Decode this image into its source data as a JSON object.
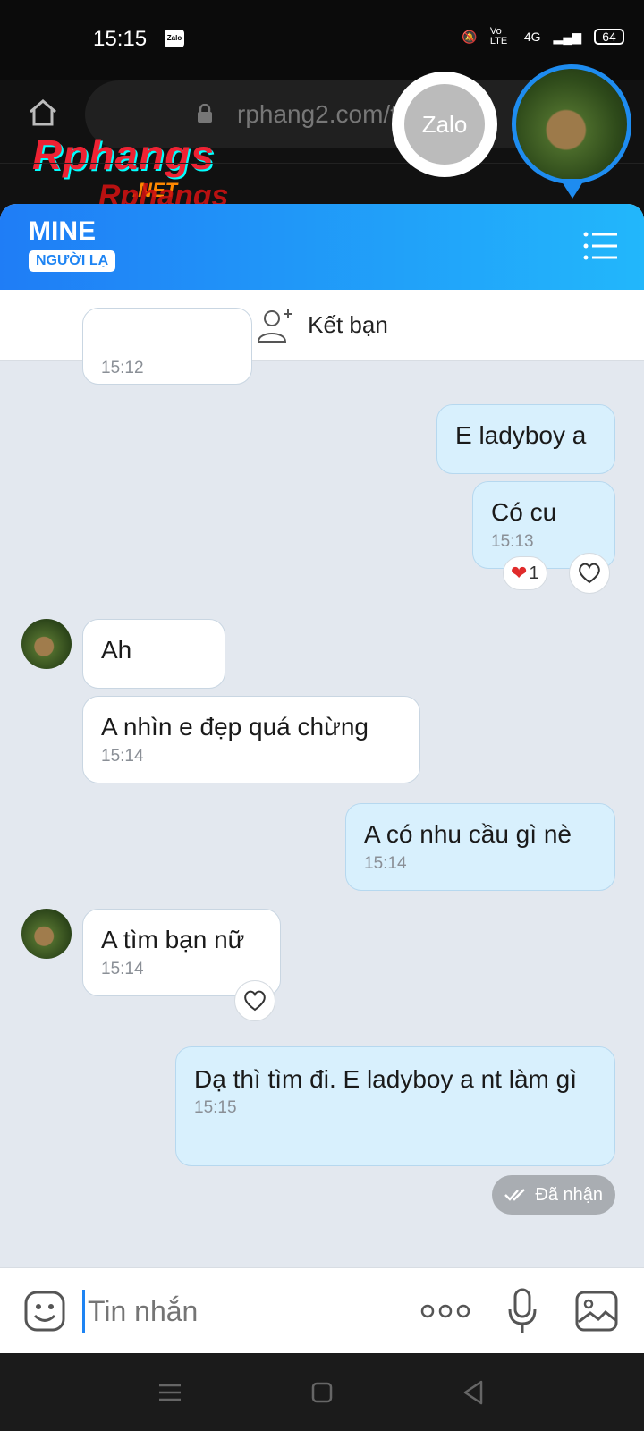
{
  "status_bar": {
    "time": "15:15",
    "zalo_icon": "Zalo",
    "network": "4G",
    "volte": "Vo LTE",
    "battery": "64"
  },
  "browser": {
    "url": "rphang2.com/threa",
    "logo": "Rphangs",
    "logo_sub": ".NET",
    "ghost_logo": "Rphangs"
  },
  "floating": {
    "zalo_label": "Zalo"
  },
  "header": {
    "name": "MINE",
    "badge": "NGƯỜI LẠ"
  },
  "friend_bar": {
    "label": "Kết bạn"
  },
  "messages": [
    {
      "side": "in",
      "text": "",
      "time": "15:12"
    },
    {
      "side": "out",
      "text": "E ladyboy a",
      "time": ""
    },
    {
      "side": "out",
      "text": "Có cu",
      "time": "15:13",
      "reaction": "1"
    },
    {
      "side": "in",
      "text": "Ah",
      "time": ""
    },
    {
      "side": "in",
      "text": "A nhìn e đẹp quá chừng",
      "time": "15:14"
    },
    {
      "side": "out",
      "text": "A có nhu cầu gì nè",
      "time": "15:14"
    },
    {
      "side": "in",
      "text": "A tìm bạn nữ",
      "time": "15:14"
    },
    {
      "side": "out",
      "text": "Dạ thì tìm đi. E ladyboy a nt làm gì",
      "time": "15:15"
    }
  ],
  "status": {
    "label": "Đã nhận"
  },
  "composer": {
    "placeholder": "Tin nhắn"
  },
  "colors": {
    "accent": "#1e84f3",
    "header_start": "#1f7df6",
    "header_end": "#22b7fb",
    "out_bubble": "#d8f0fd",
    "background": "#e3e8ef"
  },
  "icons": [
    "home-icon",
    "lock-icon",
    "menu-icon",
    "add-friend-icon",
    "heart-icon",
    "double-check-icon",
    "emoji-icon",
    "more-icon",
    "mic-icon",
    "image-icon"
  ]
}
